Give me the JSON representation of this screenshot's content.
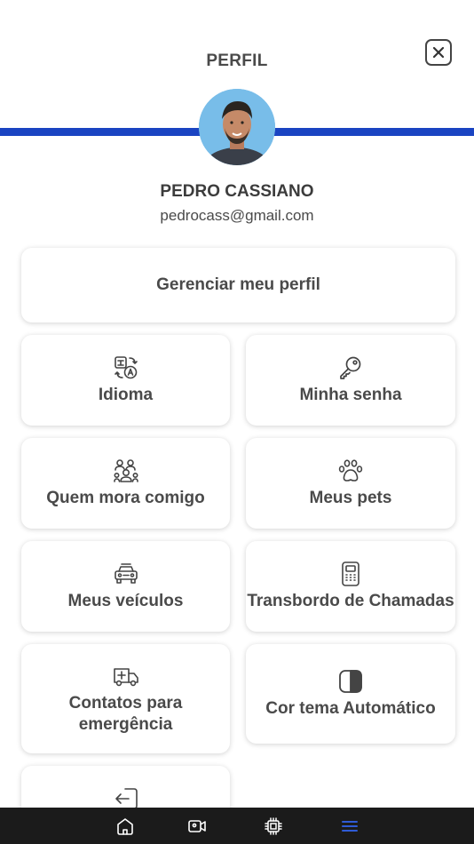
{
  "header": {
    "title": "PERFIL",
    "close_icon": "close-icon"
  },
  "profile": {
    "name": "PEDRO CASSIANO",
    "email": "pedrocass@gmail.com"
  },
  "colors": {
    "accent": "#1a44c2",
    "nav_background": "#1b1b1b",
    "nav_active": "#2f5bd6"
  },
  "menu": {
    "manage_profile": "Gerenciar meu perfil",
    "items": [
      {
        "label": "Idioma",
        "icon": "translate-icon"
      },
      {
        "label": "Minha senha",
        "icon": "key-icon"
      },
      {
        "label": "Quem mora comigo",
        "icon": "people-icon"
      },
      {
        "label": "Meus pets",
        "icon": "paw-icon"
      },
      {
        "label": "Meus veículos",
        "icon": "car-icon"
      },
      {
        "label": "Transbordo de Chamadas",
        "icon": "intercom-icon"
      },
      {
        "label": "Contatos para emergência",
        "icon": "ambulance-icon"
      },
      {
        "label": "Cor tema Automático",
        "icon": "contrast-icon"
      },
      {
        "label": "",
        "icon": "logout-icon"
      }
    ]
  },
  "bottom_nav": [
    {
      "icon": "home-icon"
    },
    {
      "icon": "video-icon"
    },
    {
      "icon": "chip-icon"
    },
    {
      "icon": "menu-icon",
      "active": true
    }
  ]
}
